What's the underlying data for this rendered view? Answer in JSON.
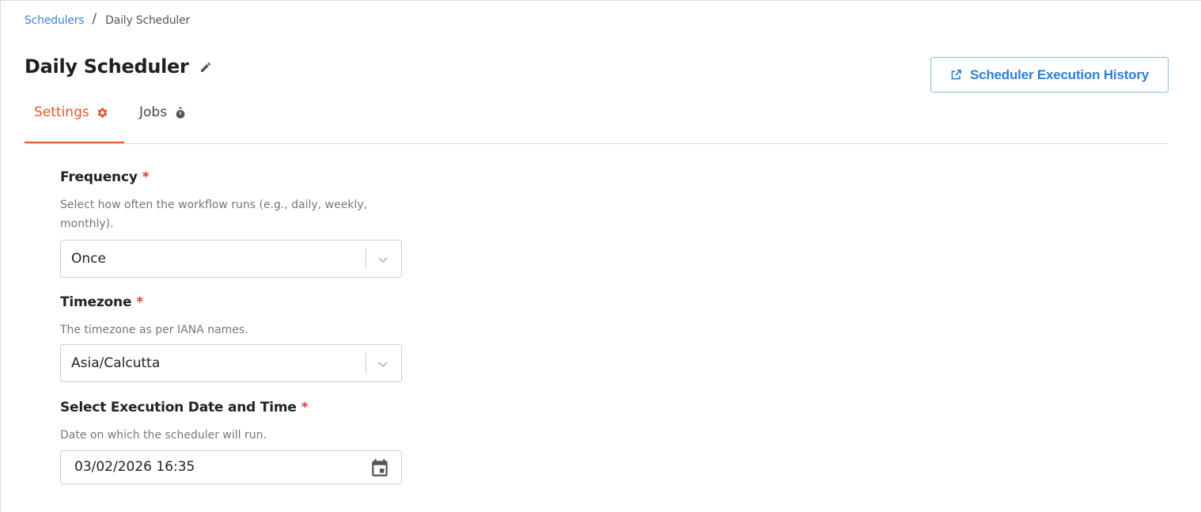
{
  "breadcrumb": {
    "parent": "Schedulers",
    "separator": "/",
    "current": "Daily Scheduler"
  },
  "page": {
    "title": "Daily Scheduler",
    "edit_icon": "pencil-icon"
  },
  "actions": {
    "history_label": "Scheduler Execution History",
    "history_icon": "external-link-icon"
  },
  "tabs": [
    {
      "label": "Settings",
      "icon": "gear-icon",
      "active": true
    },
    {
      "label": "Jobs",
      "icon": "stopwatch-icon",
      "active": false
    }
  ],
  "form": {
    "frequency": {
      "label": "Frequency",
      "required_mark": "*",
      "help": "Select how often the workflow runs (e.g., daily, weekly, monthly).",
      "value": "Once"
    },
    "timezone": {
      "label": "Timezone",
      "required_mark": "*",
      "help": "The timezone as per IANA names.",
      "value": "Asia/Calcutta"
    },
    "execution": {
      "label": "Select Execution Date and Time",
      "required_mark": "*",
      "help": "Date on which the scheduler will run.",
      "value": "03/02/2026 16:35"
    }
  },
  "colors": {
    "accent_orange": "#e0582b",
    "link_blue": "#3b82d6",
    "required_red": "#e03b3b"
  }
}
